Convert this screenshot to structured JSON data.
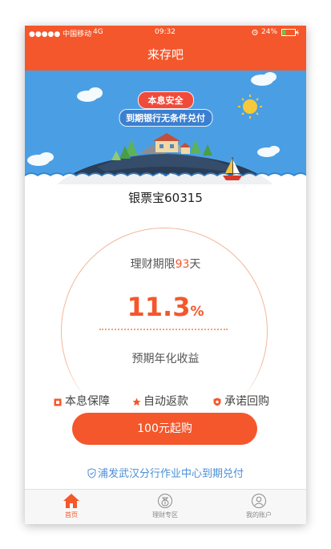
{
  "status_bar": {
    "carrier": "●●●●● 中国移动",
    "network": "4G",
    "time": "09:32",
    "battery": "24%"
  },
  "header": {
    "title": "来存吧"
  },
  "banner": {
    "badge_primary": "本息安全",
    "badge_secondary": "到期银行无条件兑付"
  },
  "product": {
    "name": "银票宝60315",
    "term_prefix": "理财期限",
    "term_days": "93",
    "term_suffix": "天",
    "rate_value": "11.3",
    "rate_unit": "%",
    "rate_label": "预期年化收益"
  },
  "features": [
    "本息保障",
    "自动返款",
    "承诺回购"
  ],
  "buy_button": {
    "label": "100元起购"
  },
  "bank_note": "浦发武汉分行作业中心到期兑付",
  "tabs": [
    {
      "label": "首页",
      "icon": "home-icon",
      "active": true
    },
    {
      "label": "理财专区",
      "icon": "money-bag-icon",
      "active": false
    },
    {
      "label": "我的账户",
      "icon": "user-icon",
      "active": false
    }
  ],
  "colors": {
    "brand": "#f4572b",
    "sky": "#4a9fe4",
    "link": "#4a8fd6"
  }
}
